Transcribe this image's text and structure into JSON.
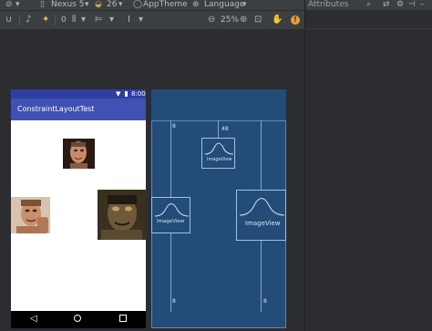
{
  "toolbar1": {
    "device": "Nexus 5",
    "api": "26",
    "theme": "AppTheme",
    "language": "Language"
  },
  "toolbar2": {
    "zoom_value": "0",
    "zoom_percent": "25%"
  },
  "attributes_panel": {
    "title": "Attributes"
  },
  "phone": {
    "status_time": "8:00",
    "app_title": "ConstraintLayoutTest"
  },
  "blueprint": {
    "label_small": "ImageView",
    "label_left": "ImageView",
    "label_right": "ImageView",
    "margin_top": "48",
    "margin_left_top": "8",
    "margin_left_bottom": "8",
    "margin_right_bottom": "8"
  },
  "colors": {
    "app_bar": "#3f51b5",
    "status_bar": "#303f9f",
    "blueprint_bg": "#234c78",
    "ide_bg": "#2b2d30"
  }
}
